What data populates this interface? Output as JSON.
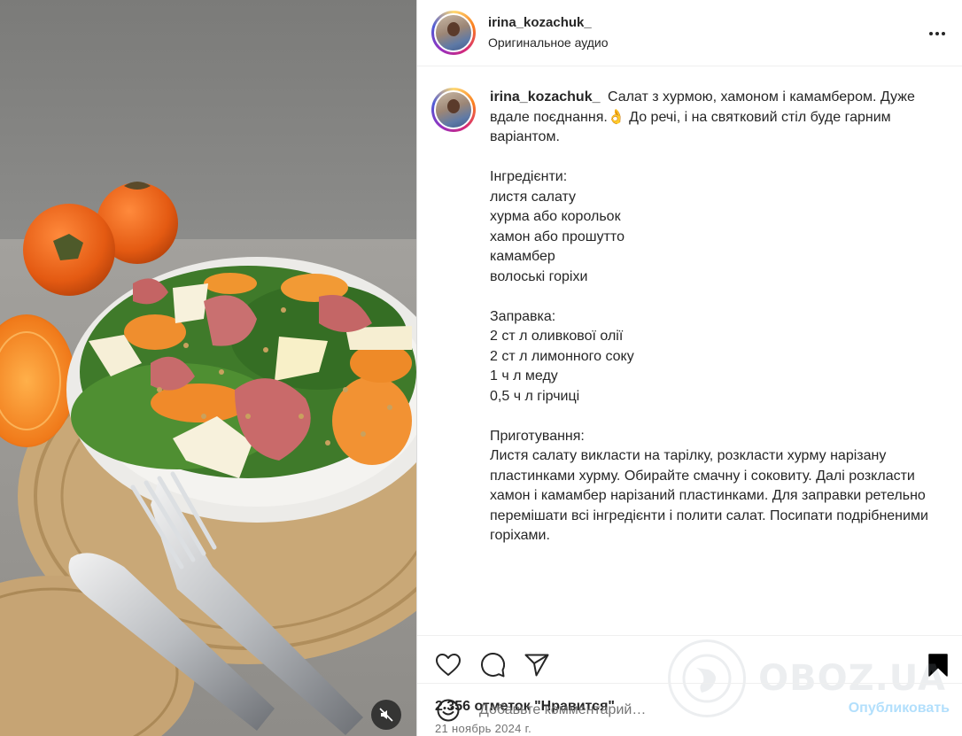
{
  "header": {
    "username": "irina_kozachuk_",
    "subtitle": "Оригинальное аудио"
  },
  "caption": {
    "username": "irina_kozachuk_",
    "intro": "Салат з хурмою, хамоном і камамбером. Дуже вдале поєднання.👌 До речі, і на святковий стіл буде гарним варіантом.",
    "ingredients_title": "Інгредієнти:",
    "ingredients": [
      "листя салату",
      "хурма або корольок",
      "хамон або прошутто",
      "камамбер",
      "волоські горіхи"
    ],
    "dressing_title": "Заправка:",
    "dressing": [
      "2 ст л оливкової олії",
      "2 ст л лимонного соку",
      "1 ч л меду",
      "0,5 ч л гірчиці"
    ],
    "prep_title": "Приготування:",
    "prep_text": "Листя салату викласти на тарілку, розкласти хурму нарізану пластинками хурму. Обирайте смачну і соковиту. Далі розкласти хамон і камамбер нарізаний пластинками. Для заправки ретельно перемішати всі інгредієнти і полити салат. Посипати подрібненими горіхами."
  },
  "actions": {
    "icons": [
      "heart-icon",
      "comment-icon",
      "share-icon",
      "bookmark-icon"
    ]
  },
  "likes": "2 356 отметок \"Нравится\"",
  "date": "21 ноябрь 2024 г.",
  "comment": {
    "placeholder": "Добавьте комментарий…",
    "publish_label": "Опубликовать"
  },
  "watermark": {
    "text": "OBOZ.UA"
  },
  "colors": {
    "publish": "#b2dffc",
    "bookmark": "#000000",
    "muted_text": "#737373"
  }
}
